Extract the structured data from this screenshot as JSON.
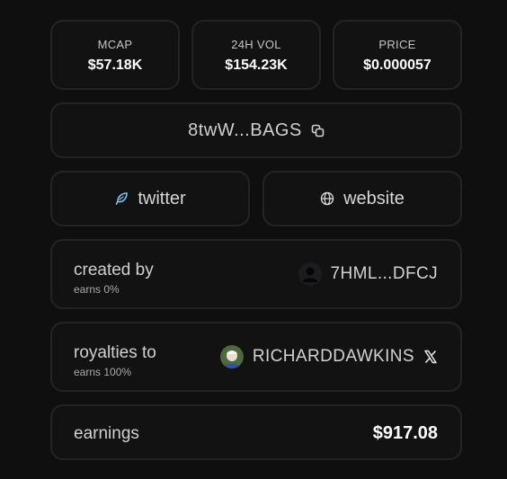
{
  "stats": [
    {
      "label": "MCAP",
      "value": "$57.18K"
    },
    {
      "label": "24H VOL",
      "value": "$154.23K"
    },
    {
      "label": "PRICE",
      "value": "$0.000057"
    }
  ],
  "address": {
    "short": "8twW...BAGS",
    "icon": "copy-icon"
  },
  "links": {
    "twitter": {
      "label": "twitter",
      "icon": "feather-icon",
      "icon_color": "#7cc4f0"
    },
    "website": {
      "label": "website",
      "icon": "globe-icon"
    }
  },
  "created_by": {
    "title": "created by",
    "sub": "earns 0%",
    "account": "7HML...DFCJ"
  },
  "royalties": {
    "title": "royalties to",
    "sub": "earns 100%",
    "account": "RICHARDDAWKINS",
    "icon": "x-logo-icon"
  },
  "earnings": {
    "title": "earnings",
    "value": "$917.08"
  },
  "colors": {
    "background": "#0f0f10",
    "card": "#121213",
    "border": "#242426"
  }
}
